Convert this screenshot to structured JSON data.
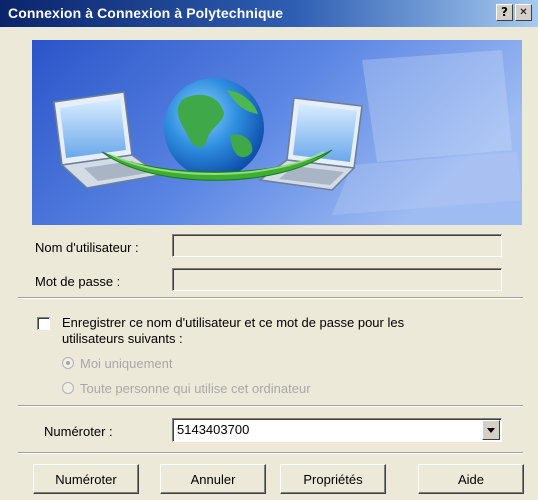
{
  "window": {
    "title": "Connexion à Connexion à Polytechnique",
    "help_button": "?",
    "close_button": "✕"
  },
  "form": {
    "username_label": "Nom d'utilisateur :",
    "username_value": "",
    "password_label": "Mot de passe :",
    "password_value": "",
    "save_checkbox": {
      "label_line1": "Enregistrer ce nom d'utilisateur et ce mot de passe pour les",
      "label_line2": "utilisateurs suivants :",
      "checked": false
    },
    "radio_options": [
      {
        "label": "Moi uniquement",
        "selected": true,
        "enabled": false
      },
      {
        "label": "Toute personne qui utilise cet ordinateur",
        "selected": false,
        "enabled": false
      }
    ],
    "dial_label": "Numéroter :",
    "dial_value": "5143403700"
  },
  "buttons": {
    "dial": "Numéroter",
    "cancel": "Annuler",
    "properties": "Propriétés",
    "help": "Aide"
  },
  "colors": {
    "title_gradient_start": "#0a246a",
    "title_gradient_end": "#a6caf0",
    "dialog_bg": "#ece9d8",
    "banner_blue": "#3f6fd8"
  },
  "icons": [
    "help-icon",
    "close-icon",
    "globe-icon",
    "laptop-icon",
    "dropdown-arrow-icon"
  ]
}
